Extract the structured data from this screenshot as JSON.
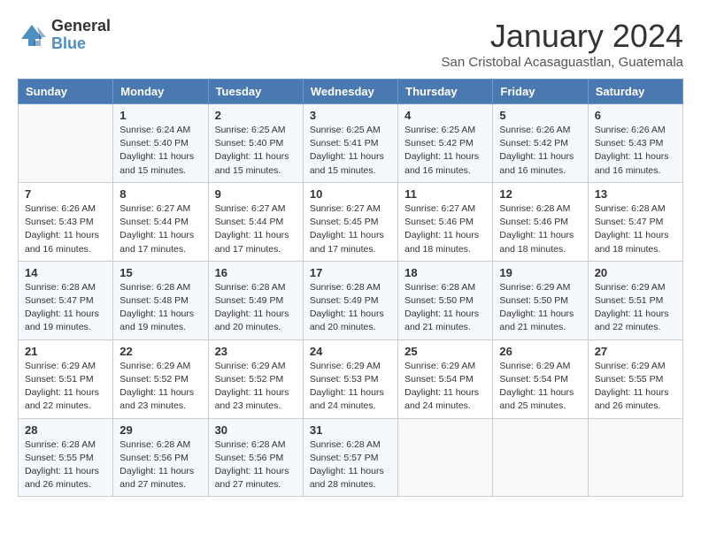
{
  "logo": {
    "general": "General",
    "blue": "Blue"
  },
  "title": "January 2024",
  "subtitle": "San Cristobal Acasaguastlan, Guatemala",
  "days_of_week": [
    "Sunday",
    "Monday",
    "Tuesday",
    "Wednesday",
    "Thursday",
    "Friday",
    "Saturday"
  ],
  "weeks": [
    [
      {
        "day": "",
        "info": ""
      },
      {
        "day": "1",
        "info": "Sunrise: 6:24 AM\nSunset: 5:40 PM\nDaylight: 11 hours and 15 minutes."
      },
      {
        "day": "2",
        "info": "Sunrise: 6:25 AM\nSunset: 5:40 PM\nDaylight: 11 hours and 15 minutes."
      },
      {
        "day": "3",
        "info": "Sunrise: 6:25 AM\nSunset: 5:41 PM\nDaylight: 11 hours and 15 minutes."
      },
      {
        "day": "4",
        "info": "Sunrise: 6:25 AM\nSunset: 5:42 PM\nDaylight: 11 hours and 16 minutes."
      },
      {
        "day": "5",
        "info": "Sunrise: 6:26 AM\nSunset: 5:42 PM\nDaylight: 11 hours and 16 minutes."
      },
      {
        "day": "6",
        "info": "Sunrise: 6:26 AM\nSunset: 5:43 PM\nDaylight: 11 hours and 16 minutes."
      }
    ],
    [
      {
        "day": "7",
        "info": "Sunrise: 6:26 AM\nSunset: 5:43 PM\nDaylight: 11 hours and 16 minutes."
      },
      {
        "day": "8",
        "info": "Sunrise: 6:27 AM\nSunset: 5:44 PM\nDaylight: 11 hours and 17 minutes."
      },
      {
        "day": "9",
        "info": "Sunrise: 6:27 AM\nSunset: 5:44 PM\nDaylight: 11 hours and 17 minutes."
      },
      {
        "day": "10",
        "info": "Sunrise: 6:27 AM\nSunset: 5:45 PM\nDaylight: 11 hours and 17 minutes."
      },
      {
        "day": "11",
        "info": "Sunrise: 6:27 AM\nSunset: 5:46 PM\nDaylight: 11 hours and 18 minutes."
      },
      {
        "day": "12",
        "info": "Sunrise: 6:28 AM\nSunset: 5:46 PM\nDaylight: 11 hours and 18 minutes."
      },
      {
        "day": "13",
        "info": "Sunrise: 6:28 AM\nSunset: 5:47 PM\nDaylight: 11 hours and 18 minutes."
      }
    ],
    [
      {
        "day": "14",
        "info": "Sunrise: 6:28 AM\nSunset: 5:47 PM\nDaylight: 11 hours and 19 minutes."
      },
      {
        "day": "15",
        "info": "Sunrise: 6:28 AM\nSunset: 5:48 PM\nDaylight: 11 hours and 19 minutes."
      },
      {
        "day": "16",
        "info": "Sunrise: 6:28 AM\nSunset: 5:49 PM\nDaylight: 11 hours and 20 minutes."
      },
      {
        "day": "17",
        "info": "Sunrise: 6:28 AM\nSunset: 5:49 PM\nDaylight: 11 hours and 20 minutes."
      },
      {
        "day": "18",
        "info": "Sunrise: 6:28 AM\nSunset: 5:50 PM\nDaylight: 11 hours and 21 minutes."
      },
      {
        "day": "19",
        "info": "Sunrise: 6:29 AM\nSunset: 5:50 PM\nDaylight: 11 hours and 21 minutes."
      },
      {
        "day": "20",
        "info": "Sunrise: 6:29 AM\nSunset: 5:51 PM\nDaylight: 11 hours and 22 minutes."
      }
    ],
    [
      {
        "day": "21",
        "info": "Sunrise: 6:29 AM\nSunset: 5:51 PM\nDaylight: 11 hours and 22 minutes."
      },
      {
        "day": "22",
        "info": "Sunrise: 6:29 AM\nSunset: 5:52 PM\nDaylight: 11 hours and 23 minutes."
      },
      {
        "day": "23",
        "info": "Sunrise: 6:29 AM\nSunset: 5:52 PM\nDaylight: 11 hours and 23 minutes."
      },
      {
        "day": "24",
        "info": "Sunrise: 6:29 AM\nSunset: 5:53 PM\nDaylight: 11 hours and 24 minutes."
      },
      {
        "day": "25",
        "info": "Sunrise: 6:29 AM\nSunset: 5:54 PM\nDaylight: 11 hours and 24 minutes."
      },
      {
        "day": "26",
        "info": "Sunrise: 6:29 AM\nSunset: 5:54 PM\nDaylight: 11 hours and 25 minutes."
      },
      {
        "day": "27",
        "info": "Sunrise: 6:29 AM\nSunset: 5:55 PM\nDaylight: 11 hours and 26 minutes."
      }
    ],
    [
      {
        "day": "28",
        "info": "Sunrise: 6:28 AM\nSunset: 5:55 PM\nDaylight: 11 hours and 26 minutes."
      },
      {
        "day": "29",
        "info": "Sunrise: 6:28 AM\nSunset: 5:56 PM\nDaylight: 11 hours and 27 minutes."
      },
      {
        "day": "30",
        "info": "Sunrise: 6:28 AM\nSunset: 5:56 PM\nDaylight: 11 hours and 27 minutes."
      },
      {
        "day": "31",
        "info": "Sunrise: 6:28 AM\nSunset: 5:57 PM\nDaylight: 11 hours and 28 minutes."
      },
      {
        "day": "",
        "info": ""
      },
      {
        "day": "",
        "info": ""
      },
      {
        "day": "",
        "info": ""
      }
    ]
  ]
}
